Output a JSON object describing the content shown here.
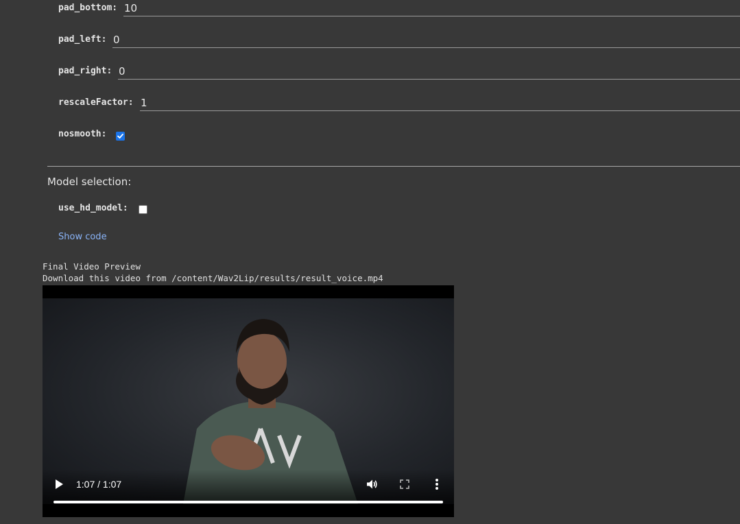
{
  "params": [
    {
      "label": "pad_bottom:",
      "value": "10"
    },
    {
      "label": "pad_left:",
      "value": "0"
    },
    {
      "label": "pad_right:",
      "value": "0"
    },
    {
      "label": "rescaleFactor:",
      "value": "1"
    }
  ],
  "nosmooth": {
    "label": "nosmooth:",
    "checked": true
  },
  "model_selection": {
    "title": "Model selection:",
    "use_hd_model": {
      "label": "use_hd_model:",
      "checked": false
    },
    "show_code": "Show code"
  },
  "output": {
    "line1": "Final Video Preview",
    "line2": "Download this video from /content/Wav2Lip/results/result_voice.mp4"
  },
  "video": {
    "time": "1:07 / 1:07",
    "progress": 1.0,
    "icons": {
      "play": "play-icon",
      "volume": "volume-icon",
      "fullscreen": "fullscreen-icon",
      "more": "more-options-icon"
    }
  },
  "colors": {
    "background": "#383838",
    "link": "#8ab4f8",
    "checkbox_checked": "#1a73e8"
  }
}
